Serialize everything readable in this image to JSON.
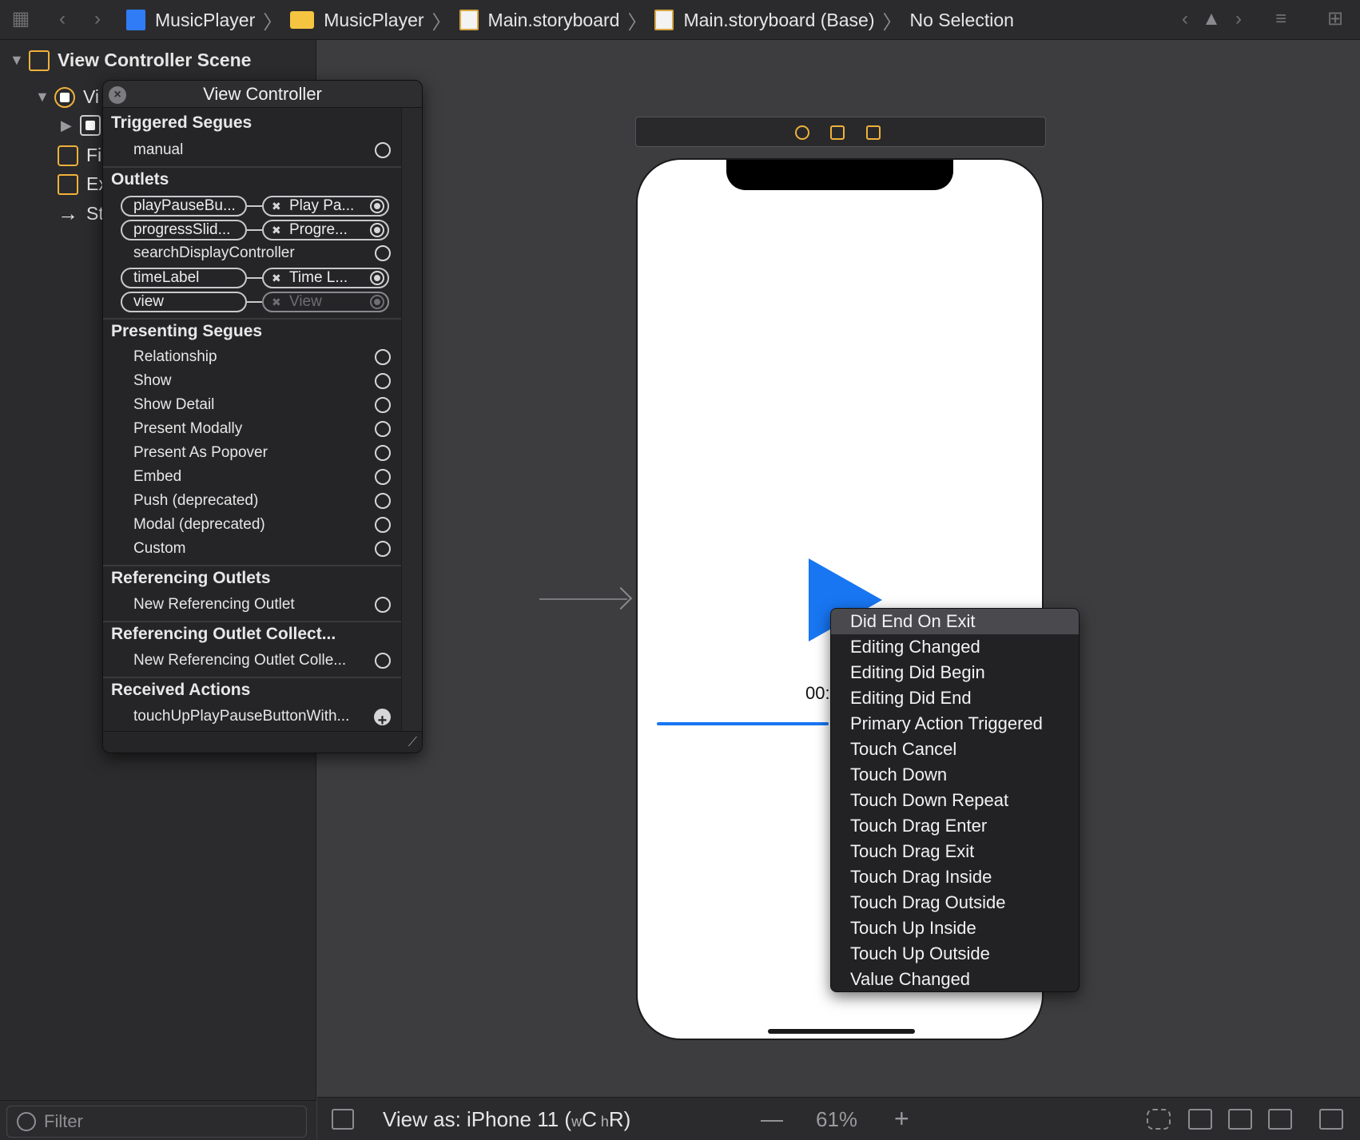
{
  "breadcrumbs": [
    {
      "label": "MusicPlayer",
      "icon": "xcode-project-icon"
    },
    {
      "label": "MusicPlayer",
      "icon": "folder-icon"
    },
    {
      "label": "Main.storyboard",
      "icon": "storyboard-file-icon"
    },
    {
      "label": "Main.storyboard (Base)",
      "icon": "storyboard-file-icon"
    },
    {
      "label": "No Selection",
      "icon": null
    }
  ],
  "navigator": {
    "scene": "View Controller Scene",
    "rows": [
      {
        "label": "Vi",
        "icon": "view-controller-icon"
      },
      {
        "label": "",
        "icon": "view-icon"
      },
      {
        "label": "Fi",
        "icon": "first-responder-icon"
      },
      {
        "label": "Ex",
        "icon": "exit-icon"
      },
      {
        "label": "St",
        "icon": "storyboard-entry-point-icon"
      }
    ],
    "filter_placeholder": "Filter"
  },
  "connections": {
    "title": "View Controller",
    "triggered_segues": {
      "header": "Triggered Segues",
      "items": [
        "manual"
      ]
    },
    "outlets": {
      "header": "Outlets",
      "items": [
        {
          "source": "playPauseBu...",
          "target": "Play Pa...",
          "connected": true,
          "dimmed": false
        },
        {
          "source": "progressSlid...",
          "target": "Progre...",
          "connected": true,
          "dimmed": false
        },
        {
          "source": "searchDisplayController",
          "target": null,
          "connected": false,
          "dimmed": false
        },
        {
          "source": "timeLabel",
          "target": "Time L...",
          "connected": true,
          "dimmed": false
        },
        {
          "source": "view",
          "target": "View",
          "connected": true,
          "dimmed": true
        }
      ]
    },
    "presenting_segues": {
      "header": "Presenting Segues",
      "items": [
        "Relationship",
        "Show",
        "Show Detail",
        "Present Modally",
        "Present As Popover",
        "Embed",
        "Push (deprecated)",
        "Modal (deprecated)",
        "Custom"
      ]
    },
    "referencing_outlets": {
      "header": "Referencing Outlets",
      "items": [
        "New Referencing Outlet"
      ]
    },
    "referencing_outlet_collections": {
      "header": "Referencing Outlet Collect...",
      "items": [
        "New Referencing Outlet Colle..."
      ]
    },
    "received_actions": {
      "header": "Received Actions",
      "items": [
        "touchUpPlayPauseButtonWith..."
      ]
    }
  },
  "canvas": {
    "time_label_partial": "00:",
    "view_as": {
      "prefix": "View as: iPhone 11 (",
      "w": "w",
      "wsize": "C",
      "h": " h",
      "hsize": "R",
      "suffix": ")"
    },
    "zoom": "61%",
    "zoom_minus": "—",
    "zoom_plus": "+"
  },
  "event_menu": {
    "selected_index": 0,
    "items": [
      "Did End On Exit",
      "Editing Changed",
      "Editing Did Begin",
      "Editing Did End",
      "Primary Action Triggered",
      "Touch Cancel",
      "Touch Down",
      "Touch Down Repeat",
      "Touch Drag Enter",
      "Touch Drag Exit",
      "Touch Drag Inside",
      "Touch Drag Outside",
      "Touch Up Inside",
      "Touch Up Outside",
      "Value Changed"
    ]
  },
  "colors": {
    "accent_blue": "#1876f2",
    "icon_orange": "#f0b13a"
  }
}
